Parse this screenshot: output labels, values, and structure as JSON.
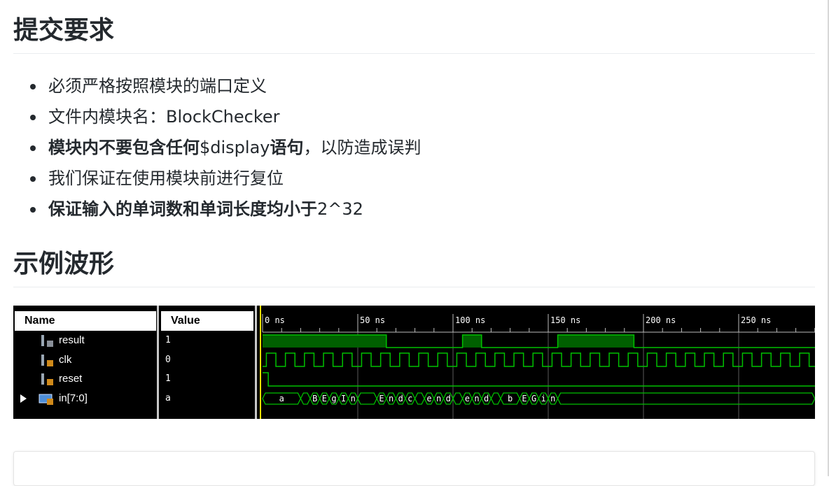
{
  "sections": {
    "submit_title": "提交要求",
    "example_title": "示例波形"
  },
  "requirements": [
    {
      "parts": [
        {
          "text": "必须严格按照模块的端口定义",
          "bold": false
        }
      ]
    },
    {
      "parts": [
        {
          "text": "文件内模块名：BlockChecker",
          "bold": false
        }
      ]
    },
    {
      "parts": [
        {
          "text": "模块内不要包含任何",
          "bold": true
        },
        {
          "text": "$display",
          "bold": false
        },
        {
          "text": "语句",
          "bold": true
        },
        {
          "text": "，以防造成误判",
          "bold": false
        }
      ]
    },
    {
      "parts": [
        {
          "text": "我们保证在使用模块前进行复位",
          "bold": false
        }
      ]
    },
    {
      "parts": [
        {
          "text": "保证输入的单词数和单词长度均小于",
          "bold": true
        },
        {
          "text": "2^32",
          "bold": false
        }
      ]
    }
  ],
  "waveform": {
    "headers": {
      "name": "Name",
      "value": "Value"
    },
    "signals": [
      {
        "name": "result",
        "value": "1",
        "icon": "signal-output-icon"
      },
      {
        "name": "clk",
        "value": "0",
        "icon": "signal-input-icon"
      },
      {
        "name": "reset",
        "value": "1",
        "icon": "signal-input-icon"
      },
      {
        "name": "in[7:0]",
        "value": "a",
        "icon": "bus-input-icon",
        "expandable": true
      }
    ],
    "time_labels": [
      "0 ns",
      "50 ns",
      "100 ns",
      "150 ns",
      "200 ns",
      "250 ns"
    ],
    "time_label_values_ns": [
      0,
      50,
      100,
      150,
      200,
      250
    ],
    "visible_end_ns": 290,
    "result_high_ns": [
      [
        0,
        65
      ],
      [
        105,
        115
      ],
      [
        155,
        195
      ]
    ],
    "clk_period_ns": 10,
    "clk_high_ns": 5,
    "reset_high_until_ns": 3,
    "in_bus_segments": [
      {
        "start": 0,
        "end": 20,
        "label": "a"
      },
      {
        "start": 20,
        "end": 25,
        "label": ""
      },
      {
        "start": 25,
        "end": 30,
        "label": "B"
      },
      {
        "start": 30,
        "end": 35,
        "label": "E"
      },
      {
        "start": 35,
        "end": 40,
        "label": "g"
      },
      {
        "start": 40,
        "end": 45,
        "label": "I"
      },
      {
        "start": 45,
        "end": 50,
        "label": "n"
      },
      {
        "start": 50,
        "end": 60,
        "label": ""
      },
      {
        "start": 60,
        "end": 65,
        "label": "E"
      },
      {
        "start": 65,
        "end": 70,
        "label": "n"
      },
      {
        "start": 70,
        "end": 75,
        "label": "d"
      },
      {
        "start": 75,
        "end": 80,
        "label": "c"
      },
      {
        "start": 80,
        "end": 85,
        "label": ""
      },
      {
        "start": 85,
        "end": 90,
        "label": "e"
      },
      {
        "start": 90,
        "end": 95,
        "label": "n"
      },
      {
        "start": 95,
        "end": 100,
        "label": "d"
      },
      {
        "start": 100,
        "end": 105,
        "label": ""
      },
      {
        "start": 105,
        "end": 110,
        "label": "e"
      },
      {
        "start": 110,
        "end": 115,
        "label": "n"
      },
      {
        "start": 115,
        "end": 120,
        "label": "d"
      },
      {
        "start": 120,
        "end": 125,
        "label": ""
      },
      {
        "start": 125,
        "end": 135,
        "label": "b"
      },
      {
        "start": 135,
        "end": 140,
        "label": "E"
      },
      {
        "start": 140,
        "end": 145,
        "label": "G"
      },
      {
        "start": 145,
        "end": 150,
        "label": "i"
      },
      {
        "start": 150,
        "end": 155,
        "label": "n"
      },
      {
        "start": 155,
        "end": 290,
        "label": ""
      }
    ],
    "colors": {
      "background": "#000000",
      "trace": "#00c000",
      "result_fill": "#006000",
      "grid": "#5a5a5a",
      "cursor": "#f0e000",
      "text": "#ffffff"
    }
  }
}
